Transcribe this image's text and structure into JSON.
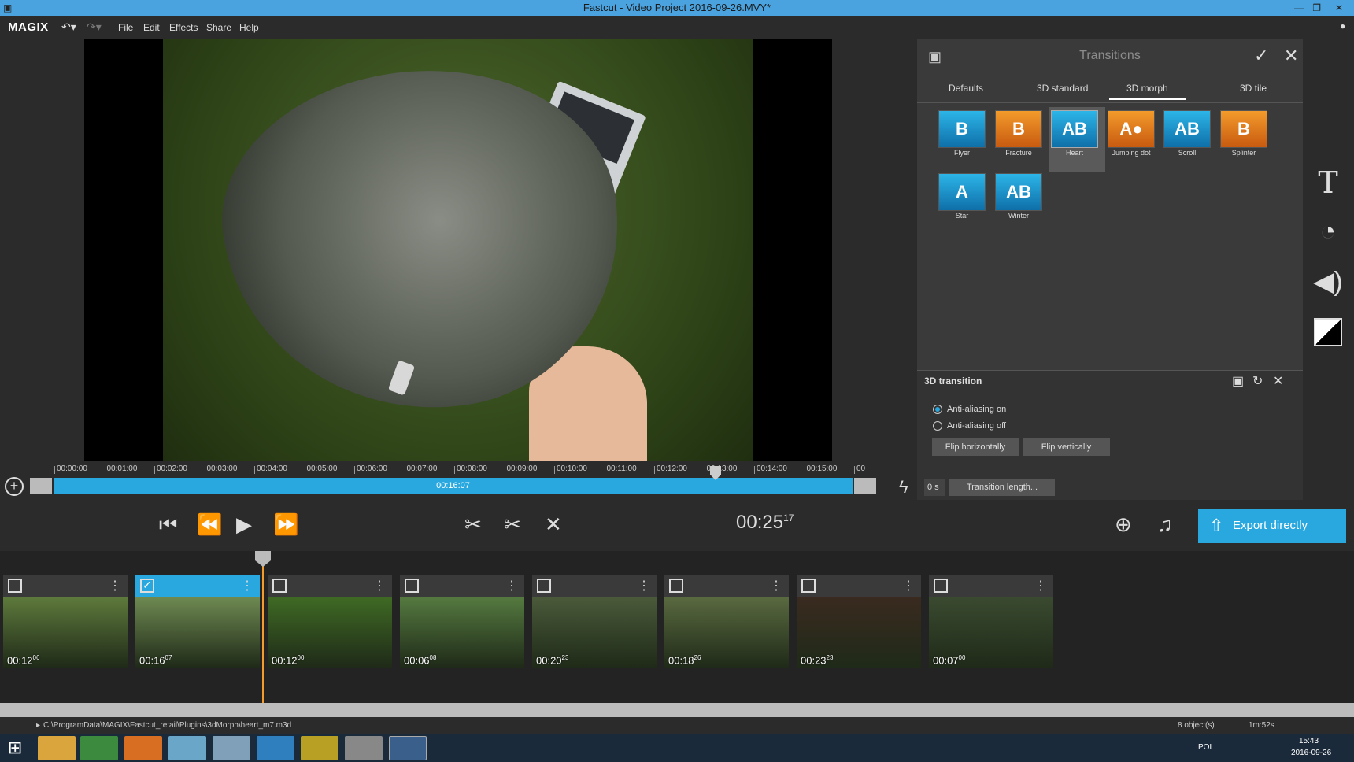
{
  "window": {
    "title": "Fastcut - Video Project 2016-09-26.MVY*"
  },
  "menubar": {
    "logo": "MAGIX",
    "items": [
      "File",
      "Edit",
      "Effects",
      "Share",
      "Help"
    ]
  },
  "ruler": {
    "ticks": [
      "00:00:00",
      "00:01:00",
      "00:02:00",
      "00:03:00",
      "00:04:00",
      "00:05:00",
      "00:06:00",
      "00:07:00",
      "00:08:00",
      "00:09:00",
      "00:10:00",
      "00:11:00",
      "00:12:00",
      "00:13:00",
      "00:14:00",
      "00:15:00",
      "00"
    ]
  },
  "scrub": {
    "time": "00:16:07"
  },
  "transitions": {
    "title": "Transitions",
    "tabs": [
      "Defaults",
      "3D standard",
      "3D morph",
      "3D tile"
    ],
    "active_tab": "3D morph",
    "items": [
      "Flyer",
      "Fracture",
      "Heart",
      "Jumping dot",
      "Scroll",
      "Splinter",
      "Star",
      "Winter"
    ],
    "selected": "Heart"
  },
  "props": {
    "title": "3D transition",
    "aa_on": "Anti-aliasing on",
    "aa_off": "Anti-aliasing off",
    "flip_h": "Flip horizontally",
    "flip_v": "Flip vertically",
    "length_value": "0 s",
    "length_button": "Transition length..."
  },
  "transport": {
    "timecode": "00:25",
    "frames": "17",
    "export": "Export directly"
  },
  "clips": [
    {
      "dur": "00:12",
      "fr": "06",
      "selected": false,
      "color": "#5e7a3c"
    },
    {
      "dur": "00:16",
      "fr": "07",
      "selected": true,
      "color": "#6f8a52"
    },
    {
      "dur": "00:12",
      "fr": "00",
      "selected": false,
      "color": "#3f6a24"
    },
    {
      "dur": "00:06",
      "fr": "08",
      "selected": false,
      "color": "#557a40"
    },
    {
      "dur": "00:20",
      "fr": "23",
      "selected": false,
      "color": "#4a5a3a"
    },
    {
      "dur": "00:18",
      "fr": "26",
      "selected": false,
      "color": "#5a6a40"
    },
    {
      "dur": "00:23",
      "fr": "23",
      "selected": false,
      "color": "#3a2a20"
    },
    {
      "dur": "00:07",
      "fr": "00",
      "selected": false,
      "color": "#3a4a30"
    }
  ],
  "status": {
    "path": "C:\\ProgramData\\MAGIX\\Fastcut_retail\\Plugins\\3dMorph\\heart_m7.m3d",
    "objects": "8 object(s)",
    "length": "1m:52s"
  },
  "taskbar": {
    "lang": "POL",
    "time": "15:43",
    "date": "2016-09-26"
  }
}
